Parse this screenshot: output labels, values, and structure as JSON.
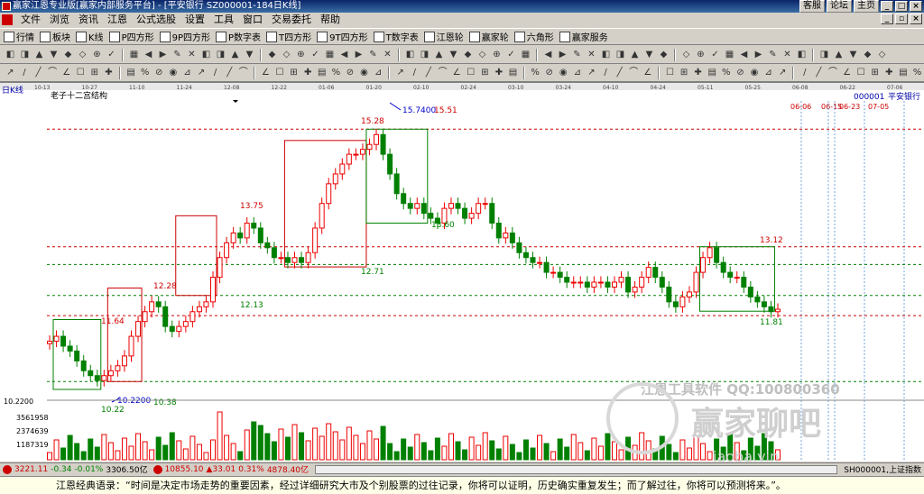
{
  "window": {
    "title": "赢家江恩专业版[赢家内部服务平台] - [平安银行   SZ000001-184日K线]",
    "links": [
      "客服",
      "论坛",
      "主页"
    ],
    "buttons": [
      "_",
      "□",
      "×"
    ]
  },
  "menu": {
    "items": [
      "文件",
      "浏览",
      "资讯",
      "江恩",
      "公式选股",
      "设置",
      "工具",
      "窗口",
      "交易委托",
      "帮助"
    ]
  },
  "toolbar1": [
    {
      "icon": "grid-icon",
      "label": "行情"
    },
    {
      "icon": "block-icon",
      "label": "板块"
    },
    {
      "icon": "candle-icon",
      "label": "K线"
    },
    {
      "icon": "p-icon",
      "label": "P四方形"
    },
    {
      "icon": "9p-icon",
      "label": "9P四方形"
    },
    {
      "icon": "pnum-icon",
      "label": "P数字表"
    },
    {
      "icon": "t-icon",
      "label": "T四方形"
    },
    {
      "icon": "9t-icon",
      "label": "9T四方形"
    },
    {
      "icon": "tn-icon",
      "label": "T数字表"
    },
    {
      "icon": "wheel-icon",
      "label": "江恩轮"
    },
    {
      "icon": "wheel2-icon",
      "label": "赢家轮"
    },
    {
      "icon": "hexagon-icon",
      "label": "六角形"
    },
    {
      "icon": "service-icon",
      "label": "赢家服务"
    }
  ],
  "chart_meta": {
    "period": "日K线",
    "indicator": "老子十二宫结构",
    "code": "000001",
    "name": "平安银行",
    "watermark1": "江恩工具软件  QQ:100800360",
    "watermark2": "赢家聊吧",
    "watermark3": "iaoba.yin"
  },
  "chart_data": {
    "type": "candlestick",
    "ylim": [
      10.0,
      16.0
    ],
    "date_ticks": [
      "10-13",
      "10-27",
      "11-10",
      "11-24",
      "12-08",
      "12-22",
      "01-06",
      "01-20",
      "02-10",
      "02-24",
      "03-10",
      "03-24",
      "04-10",
      "04-24",
      "05-11",
      "05-25",
      "06-08",
      "06-22",
      "07-06"
    ],
    "future_dates": [
      "06-06",
      "06-15",
      "06-23",
      "07-05"
    ],
    "left_axis_label": "10.2200",
    "price_labels": [
      {
        "text": "10.22",
        "value": 10.22,
        "color": "#008000"
      },
      {
        "text": "10.2200",
        "value": 10.22,
        "color": "#0000cc"
      },
      {
        "text": "10.38",
        "value": 10.38,
        "color": "#008000"
      },
      {
        "text": "11.64",
        "value": 11.64,
        "color": "#cc0000"
      },
      {
        "text": "12.28",
        "value": 12.28,
        "color": "#cc0000"
      },
      {
        "text": "12.13",
        "value": 12.13,
        "color": "#008000"
      },
      {
        "text": "13.75",
        "value": 13.75,
        "color": "#cc0000"
      },
      {
        "text": "12.71",
        "value": 12.71,
        "color": "#008000"
      },
      {
        "text": "15.28",
        "value": 15.28,
        "color": "#cc0000"
      },
      {
        "text": "15.7400",
        "value": 15.74,
        "color": "#0000cc"
      },
      {
        "text": "15.51",
        "value": 15.51,
        "color": "#cc0000"
      },
      {
        "text": "13.60",
        "value": 13.6,
        "color": "#008000"
      },
      {
        "text": "13.12",
        "value": 13.12,
        "color": "#cc0000"
      },
      {
        "text": "11.81",
        "value": 11.81,
        "color": "#008000"
      }
    ],
    "close_series": [
      11.2,
      11.3,
      11.1,
      11.0,
      10.8,
      10.6,
      10.5,
      10.4,
      10.5,
      10.6,
      10.7,
      10.9,
      11.3,
      11.6,
      11.8,
      12.0,
      11.9,
      11.5,
      11.4,
      11.5,
      11.6,
      11.8,
      11.9,
      12.0,
      12.5,
      12.9,
      13.2,
      13.4,
      13.3,
      13.6,
      13.5,
      13.2,
      13.1,
      12.9,
      12.9,
      12.8,
      12.9,
      12.8,
      13.0,
      13.5,
      14.0,
      14.4,
      14.6,
      14.8,
      15.0,
      15.0,
      15.1,
      15.2,
      15.4,
      15.0,
      14.6,
      14.2,
      14.0,
      13.9,
      14.0,
      13.8,
      13.7,
      13.6,
      13.9,
      14.0,
      13.9,
      13.7,
      13.8,
      14.0,
      14.0,
      13.6,
      13.3,
      13.4,
      13.2,
      13.0,
      12.9,
      12.8,
      12.8,
      12.6,
      12.6,
      12.5,
      12.4,
      12.4,
      12.4,
      12.3,
      12.4,
      12.4,
      12.3,
      12.4,
      12.5,
      12.2,
      12.3,
      12.5,
      12.7,
      12.5,
      12.3,
      12.0,
      11.9,
      12.1,
      12.2,
      12.6,
      12.9,
      13.1,
      12.8,
      12.6,
      12.5,
      12.5,
      12.3,
      12.1,
      12.0,
      11.9,
      11.8,
      11.85
    ],
    "volume_ticks": [
      "3561958",
      "2374639",
      "1187319"
    ],
    "boxes": [
      {
        "hi": 11.64,
        "lo": 10.22,
        "color": "#008000"
      },
      {
        "hi": 12.28,
        "lo": 10.38,
        "color": "#cc0000"
      },
      {
        "hi": 13.75,
        "lo": 12.13,
        "color": "#cc0000"
      },
      {
        "hi": 15.28,
        "lo": 12.71,
        "color": "#cc0000"
      },
      {
        "hi": 15.51,
        "lo": 13.6,
        "color": "#008000"
      },
      {
        "hi": 13.12,
        "lo": 11.81,
        "color": "#008000"
      }
    ],
    "hlines": [
      {
        "value": 15.51,
        "color": "#cc0000"
      },
      {
        "value": 13.12,
        "color": "#cc0000"
      },
      {
        "value": 12.76,
        "color": "#008000"
      },
      {
        "value": 12.13,
        "color": "#008000"
      },
      {
        "value": 11.72,
        "color": "#cc0000"
      },
      {
        "value": 10.38,
        "color": "#008000"
      }
    ]
  },
  "statusbar": {
    "sh_idx": "3221.11",
    "sh_chg": "-0.34",
    "sh_pct": "-0.01%",
    "sh_amt": "3306.50亿",
    "sz_idx": "10855.10",
    "sz_chg": "▲33.01",
    "sz_pct": "0.31%",
    "sz_amt": "4878.40亿",
    "right": "SH000001,上证指数"
  },
  "quote": {
    "text": "江恩经典语录：“时间是决定市场走势的重要因素，经过详细研究大市及个别股票的过往记录，你将可以证明，历史确实重复发生；而了解过往，你将可以预测将来。”。"
  }
}
